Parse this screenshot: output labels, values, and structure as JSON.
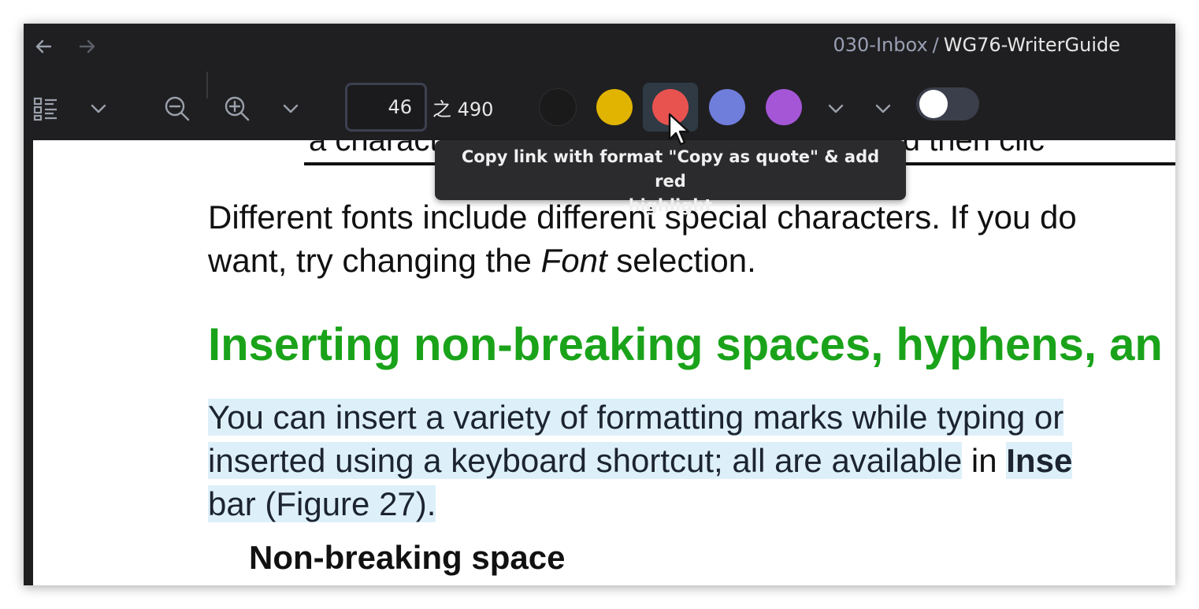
{
  "breadcrumb": {
    "parent": "030-Inbox",
    "separator": "/",
    "current": "WG76-WriterGuide"
  },
  "nav": {
    "back_icon": "arrow-left-icon",
    "forward_icon": "arrow-right-icon"
  },
  "toolbar": {
    "page_number": "46",
    "page_total": "之 490",
    "swatches": [
      {
        "name": "black",
        "color": "#1a1a1a"
      },
      {
        "name": "yellow",
        "color": "#e0b400"
      },
      {
        "name": "red",
        "color": "#e85350"
      },
      {
        "name": "blue",
        "color": "#6f7ddb"
      },
      {
        "name": "purple",
        "color": "#a556d6"
      }
    ],
    "active_swatch": "red",
    "toggle_on": false
  },
  "tooltip": {
    "line1": "Copy link with format \"Copy as quote\" & add red",
    "line2": "highlight"
  },
  "document": {
    "partial_top_line": "a character and close the dialog, click it and then clic",
    "para1_line1": "Different fonts include different special characters. If you do",
    "para1_line2_a": "want, try changing the ",
    "para1_line2_em": "Font",
    "para1_line2_b": " selection.",
    "heading": "Inserting non-breaking spaces, hyphens, an",
    "para2_line1": "You can insert a variety of formatting marks while typing or",
    "para2_line2_hl": "inserted using a keyboard shortcut; all are available",
    "para2_line2_plain": " in ",
    "para2_line2_bold": "Inse",
    "para2_line3": "bar (Figure 27).",
    "subheading": "Non-breaking space"
  },
  "colors": {
    "heading": "#1aa31a",
    "highlight": "#ddf0fa",
    "chrome": "#1f1f21"
  }
}
